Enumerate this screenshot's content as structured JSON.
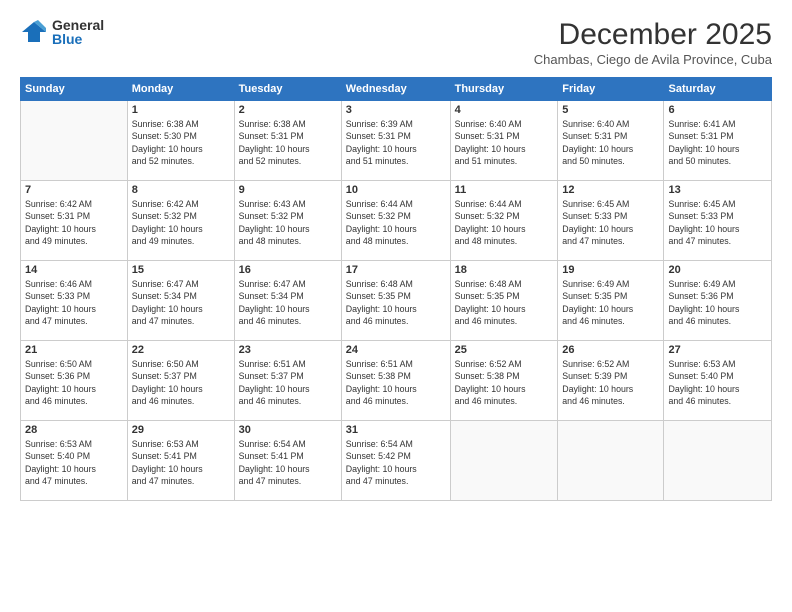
{
  "logo": {
    "general": "General",
    "blue": "Blue"
  },
  "title": "December 2025",
  "location": "Chambas, Ciego de Avila Province, Cuba",
  "headers": [
    "Sunday",
    "Monday",
    "Tuesday",
    "Wednesday",
    "Thursday",
    "Friday",
    "Saturday"
  ],
  "weeks": [
    [
      {
        "day": "",
        "info": ""
      },
      {
        "day": "1",
        "info": "Sunrise: 6:38 AM\nSunset: 5:30 PM\nDaylight: 10 hours\nand 52 minutes."
      },
      {
        "day": "2",
        "info": "Sunrise: 6:38 AM\nSunset: 5:31 PM\nDaylight: 10 hours\nand 52 minutes."
      },
      {
        "day": "3",
        "info": "Sunrise: 6:39 AM\nSunset: 5:31 PM\nDaylight: 10 hours\nand 51 minutes."
      },
      {
        "day": "4",
        "info": "Sunrise: 6:40 AM\nSunset: 5:31 PM\nDaylight: 10 hours\nand 51 minutes."
      },
      {
        "day": "5",
        "info": "Sunrise: 6:40 AM\nSunset: 5:31 PM\nDaylight: 10 hours\nand 50 minutes."
      },
      {
        "day": "6",
        "info": "Sunrise: 6:41 AM\nSunset: 5:31 PM\nDaylight: 10 hours\nand 50 minutes."
      }
    ],
    [
      {
        "day": "7",
        "info": "Sunrise: 6:42 AM\nSunset: 5:31 PM\nDaylight: 10 hours\nand 49 minutes."
      },
      {
        "day": "8",
        "info": "Sunrise: 6:42 AM\nSunset: 5:32 PM\nDaylight: 10 hours\nand 49 minutes."
      },
      {
        "day": "9",
        "info": "Sunrise: 6:43 AM\nSunset: 5:32 PM\nDaylight: 10 hours\nand 48 minutes."
      },
      {
        "day": "10",
        "info": "Sunrise: 6:44 AM\nSunset: 5:32 PM\nDaylight: 10 hours\nand 48 minutes."
      },
      {
        "day": "11",
        "info": "Sunrise: 6:44 AM\nSunset: 5:32 PM\nDaylight: 10 hours\nand 48 minutes."
      },
      {
        "day": "12",
        "info": "Sunrise: 6:45 AM\nSunset: 5:33 PM\nDaylight: 10 hours\nand 47 minutes."
      },
      {
        "day": "13",
        "info": "Sunrise: 6:45 AM\nSunset: 5:33 PM\nDaylight: 10 hours\nand 47 minutes."
      }
    ],
    [
      {
        "day": "14",
        "info": "Sunrise: 6:46 AM\nSunset: 5:33 PM\nDaylight: 10 hours\nand 47 minutes."
      },
      {
        "day": "15",
        "info": "Sunrise: 6:47 AM\nSunset: 5:34 PM\nDaylight: 10 hours\nand 47 minutes."
      },
      {
        "day": "16",
        "info": "Sunrise: 6:47 AM\nSunset: 5:34 PM\nDaylight: 10 hours\nand 46 minutes."
      },
      {
        "day": "17",
        "info": "Sunrise: 6:48 AM\nSunset: 5:35 PM\nDaylight: 10 hours\nand 46 minutes."
      },
      {
        "day": "18",
        "info": "Sunrise: 6:48 AM\nSunset: 5:35 PM\nDaylight: 10 hours\nand 46 minutes."
      },
      {
        "day": "19",
        "info": "Sunrise: 6:49 AM\nSunset: 5:35 PM\nDaylight: 10 hours\nand 46 minutes."
      },
      {
        "day": "20",
        "info": "Sunrise: 6:49 AM\nSunset: 5:36 PM\nDaylight: 10 hours\nand 46 minutes."
      }
    ],
    [
      {
        "day": "21",
        "info": "Sunrise: 6:50 AM\nSunset: 5:36 PM\nDaylight: 10 hours\nand 46 minutes."
      },
      {
        "day": "22",
        "info": "Sunrise: 6:50 AM\nSunset: 5:37 PM\nDaylight: 10 hours\nand 46 minutes."
      },
      {
        "day": "23",
        "info": "Sunrise: 6:51 AM\nSunset: 5:37 PM\nDaylight: 10 hours\nand 46 minutes."
      },
      {
        "day": "24",
        "info": "Sunrise: 6:51 AM\nSunset: 5:38 PM\nDaylight: 10 hours\nand 46 minutes."
      },
      {
        "day": "25",
        "info": "Sunrise: 6:52 AM\nSunset: 5:38 PM\nDaylight: 10 hours\nand 46 minutes."
      },
      {
        "day": "26",
        "info": "Sunrise: 6:52 AM\nSunset: 5:39 PM\nDaylight: 10 hours\nand 46 minutes."
      },
      {
        "day": "27",
        "info": "Sunrise: 6:53 AM\nSunset: 5:40 PM\nDaylight: 10 hours\nand 46 minutes."
      }
    ],
    [
      {
        "day": "28",
        "info": "Sunrise: 6:53 AM\nSunset: 5:40 PM\nDaylight: 10 hours\nand 47 minutes."
      },
      {
        "day": "29",
        "info": "Sunrise: 6:53 AM\nSunset: 5:41 PM\nDaylight: 10 hours\nand 47 minutes."
      },
      {
        "day": "30",
        "info": "Sunrise: 6:54 AM\nSunset: 5:41 PM\nDaylight: 10 hours\nand 47 minutes."
      },
      {
        "day": "31",
        "info": "Sunrise: 6:54 AM\nSunset: 5:42 PM\nDaylight: 10 hours\nand 47 minutes."
      },
      {
        "day": "",
        "info": ""
      },
      {
        "day": "",
        "info": ""
      },
      {
        "day": "",
        "info": ""
      }
    ]
  ]
}
